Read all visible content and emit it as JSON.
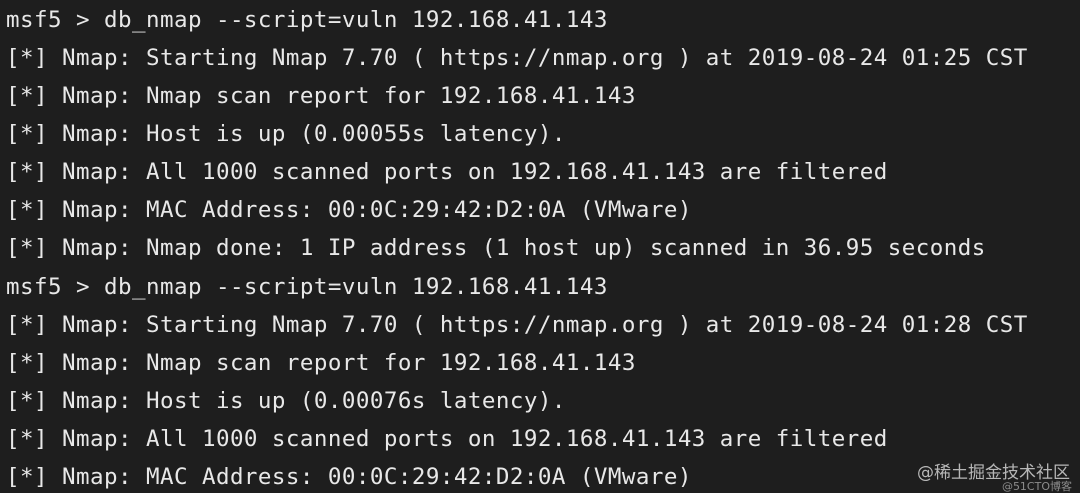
{
  "terminal": {
    "lines": [
      "msf5 > db_nmap --script=vuln 192.168.41.143",
      "[*] Nmap: Starting Nmap 7.70 ( https://nmap.org ) at 2019-08-24 01:25 CST",
      "[*] Nmap: Nmap scan report for 192.168.41.143",
      "[*] Nmap: Host is up (0.00055s latency).",
      "[*] Nmap: All 1000 scanned ports on 192.168.41.143 are filtered",
      "[*] Nmap: MAC Address: 00:0C:29:42:D2:0A (VMware)",
      "[*] Nmap: Nmap done: 1 IP address (1 host up) scanned in 36.95 seconds",
      "msf5 > db_nmap --script=vuln 192.168.41.143",
      "[*] Nmap: Starting Nmap 7.70 ( https://nmap.org ) at 2019-08-24 01:28 CST",
      "[*] Nmap: Nmap scan report for 192.168.41.143",
      "[*] Nmap: Host is up (0.00076s latency).",
      "[*] Nmap: All 1000 scanned ports on 192.168.41.143 are filtered",
      "[*] Nmap: MAC Address: 00:0C:29:42:D2:0A (VMware)"
    ]
  },
  "watermark": {
    "main": "@稀土掘金技术社区",
    "small": "@51CTO博客"
  },
  "colors": {
    "background": "#1e1e1e",
    "text": "#e8e8e8"
  }
}
